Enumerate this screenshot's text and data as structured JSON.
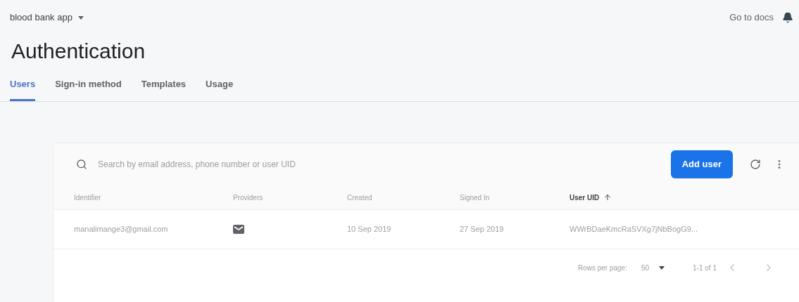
{
  "project": {
    "name": "blood bank app"
  },
  "header_link": "Go to docs",
  "title": "Authentication",
  "tabs": [
    {
      "label": "Users",
      "selected": true
    },
    {
      "label": "Sign-in method",
      "selected": false
    },
    {
      "label": "Templates",
      "selected": false
    },
    {
      "label": "Usage",
      "selected": false
    }
  ],
  "search": {
    "placeholder": "Search by email address, phone number or user UID"
  },
  "add_button": "Add user",
  "table": {
    "columns": [
      {
        "label": "Identifier",
        "sorted": false
      },
      {
        "label": "Providers",
        "sorted": false
      },
      {
        "label": "Created",
        "sorted": false
      },
      {
        "label": "Signed In",
        "sorted": false
      },
      {
        "label": "User UID",
        "sorted": true
      }
    ],
    "rows": [
      {
        "identifier": "manalimange3@gmail.com",
        "email_provider": true,
        "created": "10 Sep 2019",
        "signed_in": "27 Sep 2019",
        "uid": "WWrBDaeKmcRaSVXg7jNbBogG9..."
      }
    ]
  },
  "pagination": {
    "rows_per_page_label": "Rows per page:",
    "rows_per_page": "50",
    "range": "1-1 of 1"
  }
}
